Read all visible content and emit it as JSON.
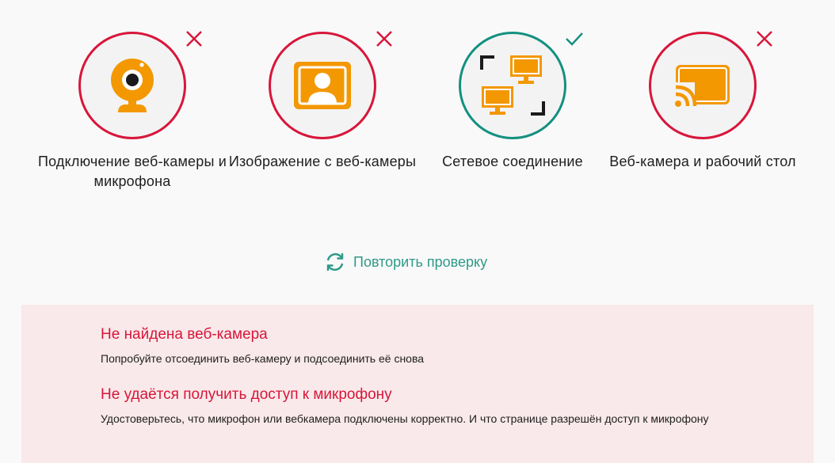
{
  "checks": [
    {
      "label": "Подключение веб-камеры и микрофона",
      "status": "fail",
      "icon": "webcam-icon"
    },
    {
      "label": "Изображение с веб-камеры",
      "status": "fail",
      "icon": "user-picture-icon"
    },
    {
      "label": "Сетевое соединение",
      "status": "ok",
      "icon": "network-icon"
    },
    {
      "label": "Веб-камера и рабочий стол",
      "status": "fail",
      "icon": "screen-cast-icon"
    }
  ],
  "retry": {
    "label": "Повторить проверку",
    "icon": "refresh-icon"
  },
  "errors": [
    {
      "title": "Не найдена веб-камера",
      "description": "Попробуйте отсоединить веб-камеру и подсоединить её снова"
    },
    {
      "title": "Не удаётся получить доступ к микрофону",
      "description": "Удостоверьтесь, что микрофон или вебкамера подключены корректно. И что странице разрешён доступ к микрофону"
    }
  ],
  "colors": {
    "fail": "#d8163a",
    "ok": "#139080",
    "icon": "#f39800",
    "retry": "#2e9a88",
    "error_bg": "#f9e9ea"
  }
}
